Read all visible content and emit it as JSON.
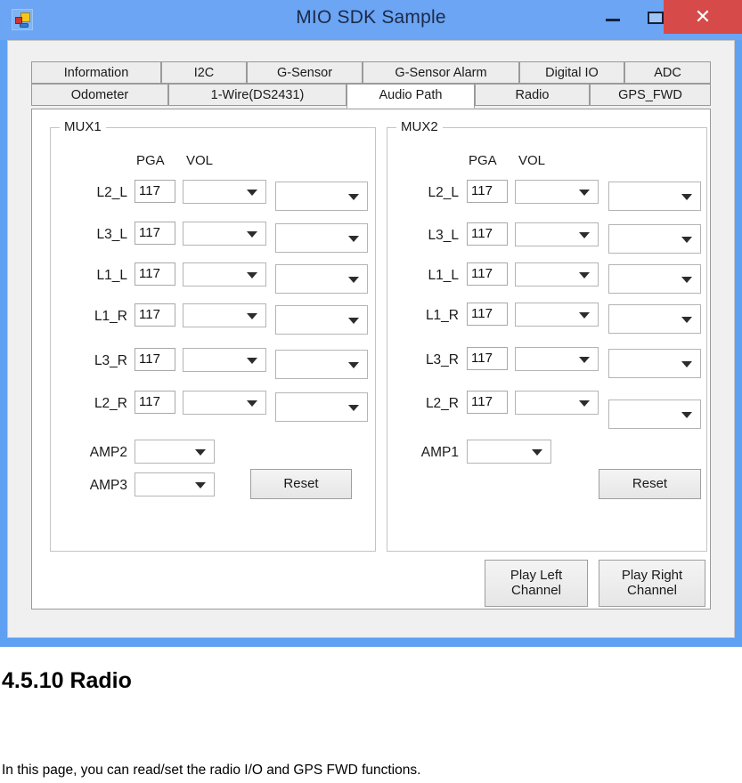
{
  "window": {
    "title": "MIO SDK Sample",
    "icon": "visual-studio-app-icon",
    "controls": {
      "minimize": "–",
      "maximize": "☐",
      "close": "✕"
    },
    "colors": {
      "titlebar": "#6BA5F4",
      "frame": "#5EA0F2",
      "close_button": "#D64A4A",
      "client": "#F0F0F0",
      "tab_selected": "#FFFFFF"
    }
  },
  "tabs": {
    "row1": [
      {
        "label": "Information",
        "selected": false
      },
      {
        "label": "I2C",
        "selected": false
      },
      {
        "label": "G-Sensor",
        "selected": false
      },
      {
        "label": "G-Sensor Alarm",
        "selected": false
      },
      {
        "label": "Digital IO",
        "selected": false
      },
      {
        "label": "ADC",
        "selected": false
      }
    ],
    "row2": [
      {
        "label": "Odometer",
        "selected": false
      },
      {
        "label": "1-Wire(DS2431)",
        "selected": false
      },
      {
        "label": "Audio Path",
        "selected": true
      },
      {
        "label": "Radio",
        "selected": false
      },
      {
        "label": "GPS_FWD",
        "selected": false
      }
    ]
  },
  "mux1": {
    "title": "MUX1",
    "headers": {
      "pga": "PGA",
      "vol": "VOL"
    },
    "rows": [
      {
        "label": "L2_L",
        "pga": "117",
        "vol": "",
        "path": ""
      },
      {
        "label": "L3_L",
        "pga": "117",
        "vol": "",
        "path": ""
      },
      {
        "label": "L1_L",
        "pga": "117",
        "vol": "",
        "path": ""
      },
      {
        "label": "L1_R",
        "pga": "117",
        "vol": "",
        "path": ""
      },
      {
        "label": "L3_R",
        "pga": "117",
        "vol": "",
        "path": ""
      },
      {
        "label": "L2_R",
        "pga": "117",
        "vol": "",
        "path": ""
      }
    ],
    "amp2": {
      "label": "AMP2",
      "value": ""
    },
    "amp3": {
      "label": "AMP3",
      "value": ""
    },
    "reset": "Reset"
  },
  "mux2": {
    "title": "MUX2",
    "headers": {
      "pga": "PGA",
      "vol": "VOL"
    },
    "rows": [
      {
        "label": "L2_L",
        "pga": "117",
        "vol": "",
        "path": ""
      },
      {
        "label": "L3_L",
        "pga": "117",
        "vol": "",
        "path": ""
      },
      {
        "label": "L1_L",
        "pga": "117",
        "vol": "",
        "path": ""
      },
      {
        "label": "L1_R",
        "pga": "117",
        "vol": "",
        "path": ""
      },
      {
        "label": "L3_R",
        "pga": "117",
        "vol": "",
        "path": ""
      },
      {
        "label": "L2_R",
        "pga": "117",
        "vol": "",
        "path": ""
      }
    ],
    "amp1": {
      "label": "AMP1",
      "value": ""
    },
    "reset": "Reset"
  },
  "playback": {
    "play_left": "Play Left\nChannel",
    "play_right": "Play Right\nChannel"
  },
  "document": {
    "heading": "4.5.10 Radio",
    "paragraph": "In this page, you can read/set the radio I/O and GPS FWD functions."
  }
}
